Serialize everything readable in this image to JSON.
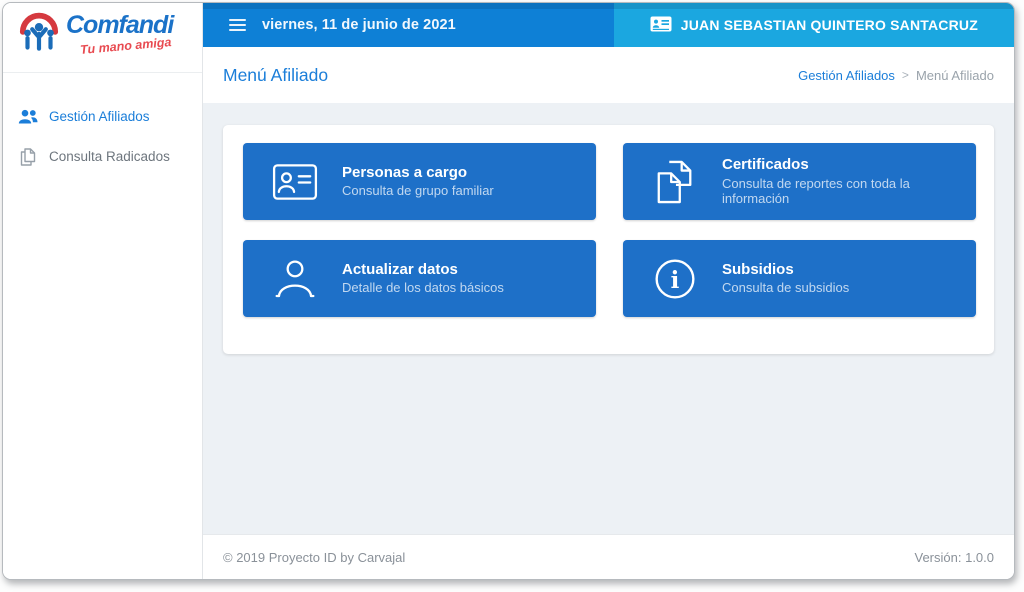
{
  "brand": {
    "name": "Comfandi",
    "tagline": "Tu mano amiga",
    "logo_icon": "comfandi-family-arch-icon"
  },
  "topbar": {
    "menu_icon": "hamburger-icon",
    "date": "viernes, 11 de junio de 2021",
    "user_icon": "id-card-icon",
    "user_name": "JUAN SEBASTIAN QUINTERO SANTACRUZ"
  },
  "sidebar": {
    "items": [
      {
        "label": "Gestión Afiliados",
        "icon": "users-icon",
        "active": true
      },
      {
        "label": "Consulta Radicados",
        "icon": "documents-icon",
        "active": false
      }
    ]
  },
  "page": {
    "title": "Menú Afiliado",
    "breadcrumb": {
      "parent": "Gestión Afiliados",
      "separator": ">",
      "current": "Menú Afiliado"
    }
  },
  "cards": [
    {
      "title": "Personas a cargo",
      "subtitle": "Consulta de grupo familiar",
      "icon": "id-badge-icon"
    },
    {
      "title": "Certificados",
      "subtitle": "Consulta de reportes con toda la información",
      "icon": "copy-documents-icon"
    },
    {
      "title": "Actualizar datos",
      "subtitle": "Detalle de los datos básicos",
      "icon": "person-outline-icon"
    },
    {
      "title": "Subsidios",
      "subtitle": "Consulta de subsidios",
      "icon": "info-circle-icon"
    }
  ],
  "footer": {
    "copyright": "© 2019 Proyecto ID by Carvajal",
    "version": "Versión: 1.0.0"
  },
  "colors": {
    "topbar_left_blue": "#0e80d6",
    "topbar_right_blue": "#1ba7e0",
    "card_blue": "#1e70c8",
    "link_blue": "#1b7ed9",
    "brand_blue": "#1b72c8",
    "brand_red": "#e84a50",
    "content_background": "#edf1f5",
    "muted_gray": "#8a9199"
  }
}
